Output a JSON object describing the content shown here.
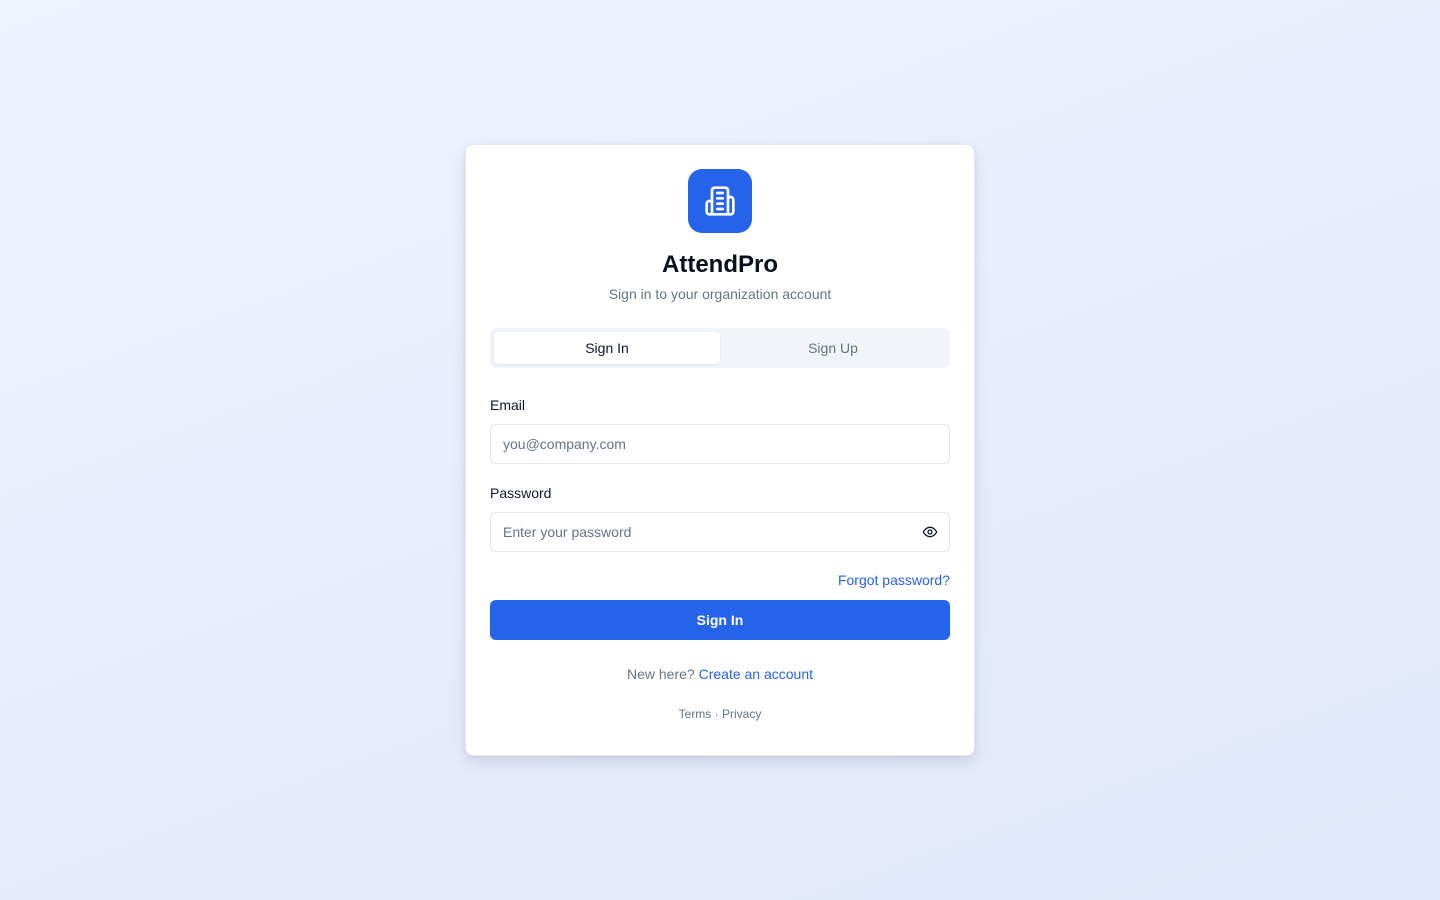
{
  "app": {
    "name": "AttendPro",
    "subtitle": "Sign in to your organization account",
    "logo_icon": "building-icon",
    "accent_color": "#2563eb"
  },
  "tabs": [
    {
      "label": "Sign In",
      "active": true
    },
    {
      "label": "Sign Up",
      "active": false
    }
  ],
  "form": {
    "email_label": "Email",
    "email_value": "",
    "email_placeholder": "you@company.com",
    "password_label": "Password",
    "password_value": "",
    "password_placeholder": "Enter your password",
    "password_toggle_icon": "eye-icon",
    "forgot_label": "Forgot password?",
    "submit_label": "Sign In"
  },
  "signup_prompt": {
    "text": "New here?",
    "link": "Create an account"
  },
  "footer": {
    "terms": "Terms",
    "separator": "·",
    "privacy": "Privacy"
  }
}
